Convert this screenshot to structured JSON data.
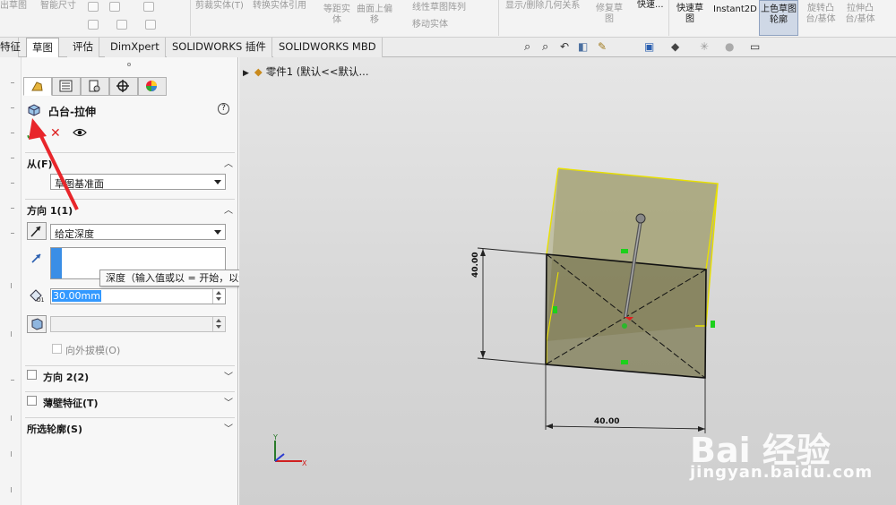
{
  "ribbon": {
    "items": [
      "出草图",
      "智能尺寸",
      "剪裁实体(T)",
      "转换实体引用",
      "等距实体",
      "曲面上偏移",
      "线性草图阵列",
      "移动实体",
      "显示/删除几何关系",
      "修复草图",
      "快速...",
      "快速草图",
      "Instant2D",
      "上色草图轮廓",
      "旋转凸台/基体",
      "拉伸凸台/基体"
    ]
  },
  "tabs": [
    "特征",
    "草图",
    "评估",
    "DimXpert",
    "SOLIDWORKS 插件",
    "SOLIDWORKS MBD"
  ],
  "active_tab_index": 1,
  "property_manager": {
    "title": "凸台-拉伸",
    "help_symbol": "?",
    "from": {
      "label": "从(F)",
      "value": "草图基准面"
    },
    "direction1": {
      "label": "方向 1(1)",
      "end_condition": "给定深度",
      "depth_value": "30.00mm",
      "draft_outward": "向外拔模(O)",
      "tooltip": "深度（输入值或以 = 开始，以创建方程式）"
    },
    "direction2": {
      "label": "方向 2(2)"
    },
    "thin_feature": {
      "label": "薄壁特征(T)"
    },
    "selected_contours": {
      "label": "所选轮廓(S)"
    }
  },
  "viewport": {
    "tree_node": "零件1 (默认<<默认...",
    "dim_vertical": "40.00",
    "dim_horizontal": "40.00",
    "triad_x": "X",
    "triad_y": "Y"
  },
  "watermark": {
    "brand": "Bai 经验",
    "url": "jingyan.baidu.com"
  },
  "colors": {
    "accent_red_arrow": "#e8262b",
    "preview_fill": "#8e8b5e",
    "preview_edge": "#e8e000",
    "selection_blue": "#3399ff"
  }
}
